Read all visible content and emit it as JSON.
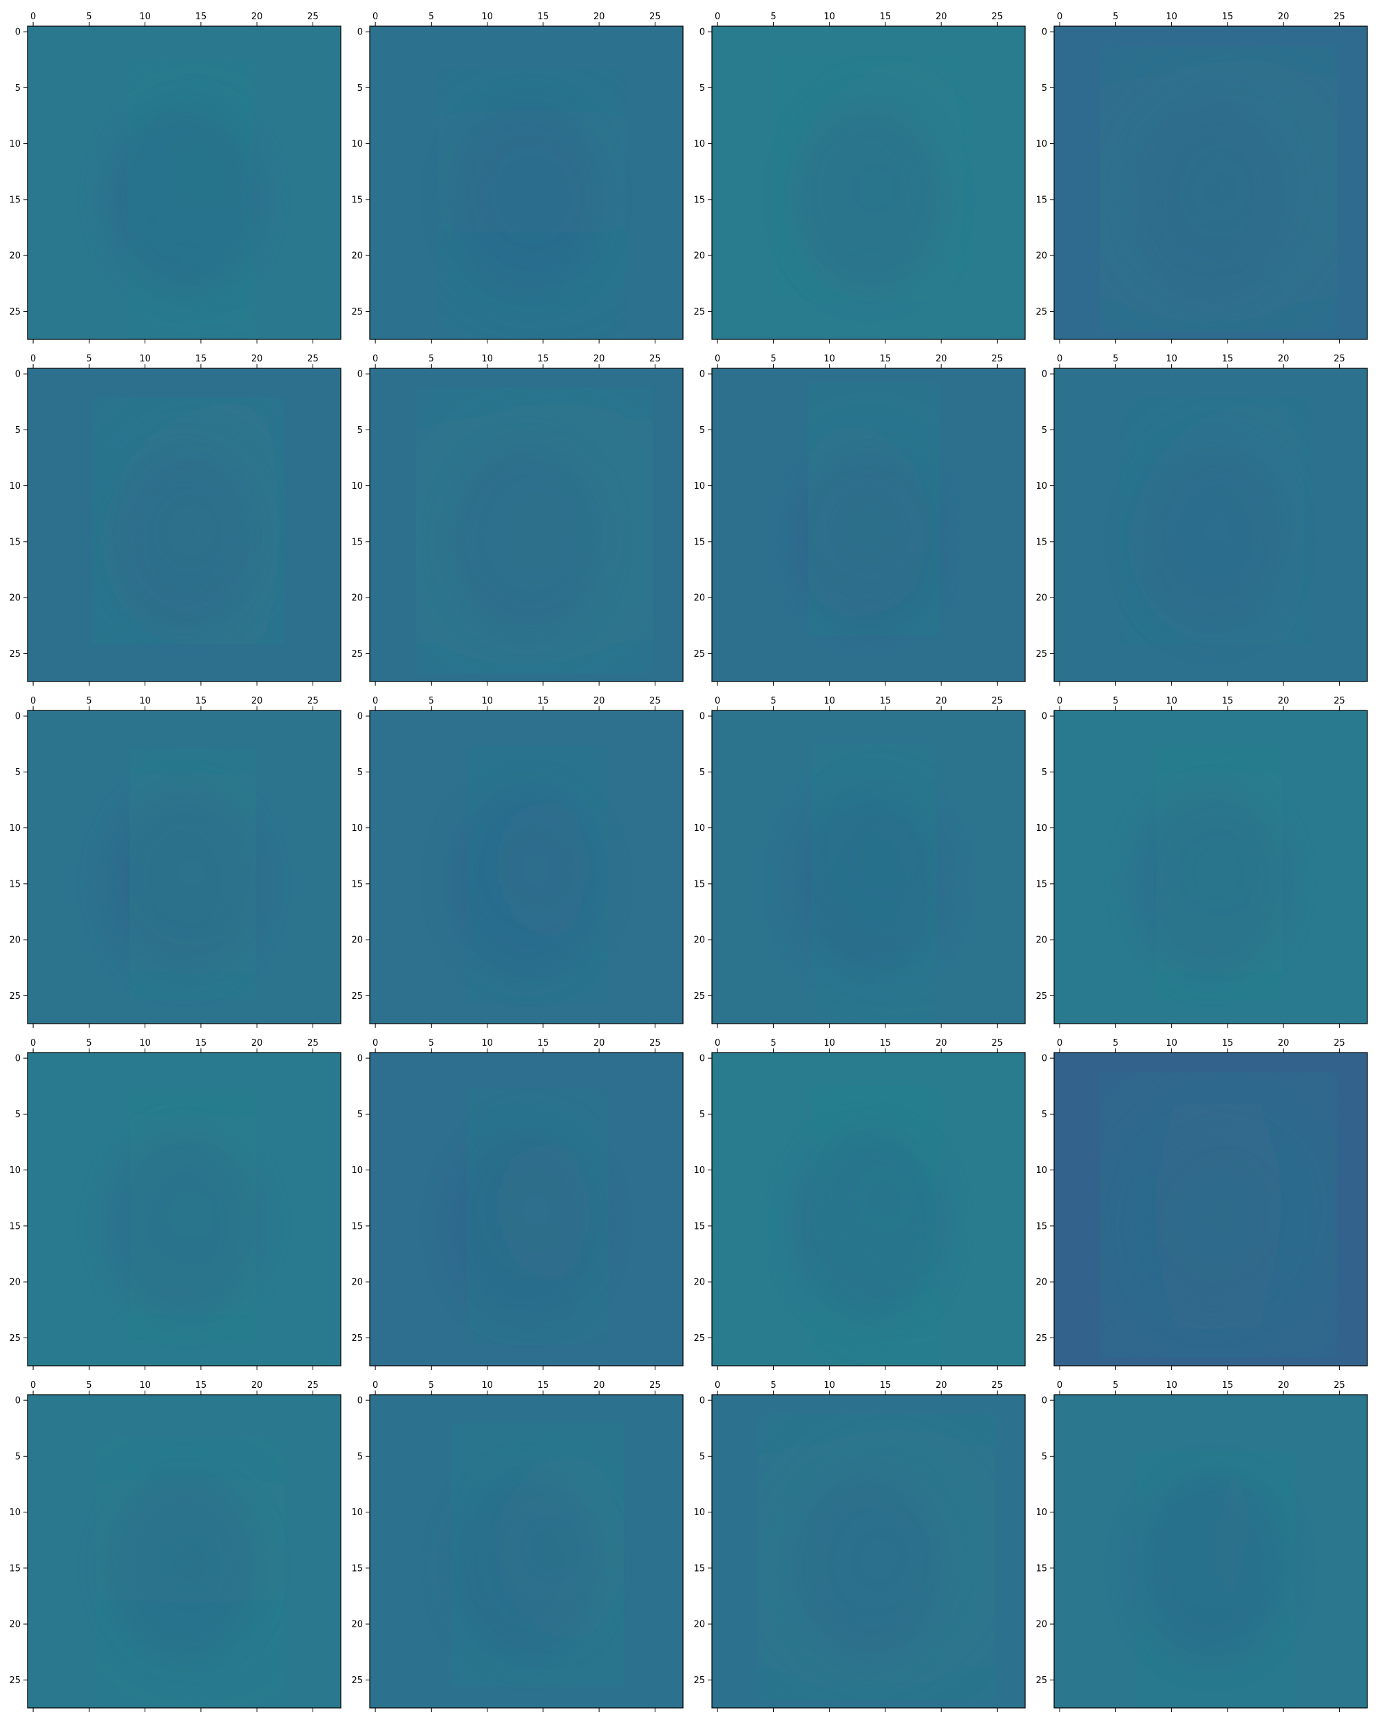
{
  "figure": {
    "rows": 5,
    "cols": 4,
    "cmap": "viridis"
  },
  "chart_data": {
    "type": "heatmap",
    "grid_shape": [
      5,
      4
    ],
    "image_shape": [
      28,
      28
    ],
    "x_axis": {
      "position": "top",
      "xlim": [
        -0.5,
        27.5
      ],
      "ticks": [
        0,
        5,
        10,
        15,
        20,
        25
      ]
    },
    "y_axis": {
      "ylim": [
        27.5,
        -0.5
      ],
      "ticks": [
        0,
        5,
        10,
        15,
        20,
        25
      ]
    },
    "grid": false,
    "legend": "none",
    "panels": [
      {
        "digit": "9",
        "background": "#2a788e",
        "stroke": "#23a083",
        "level": 0.45
      },
      {
        "digit": "4",
        "background": "#2c718e",
        "stroke": "#21918c",
        "level": 0.55
      },
      {
        "digit": "2",
        "background": "#297b8e",
        "stroke": "#23a083",
        "level": 0.25
      },
      {
        "digit": "0",
        "background": "#2f6b8e",
        "stroke": "#20a486",
        "level": 0.7
      },
      {
        "digit": "2",
        "background": "#2d708e",
        "stroke": "#22a884",
        "level": 0.75
      },
      {
        "digit": "0",
        "background": "#2d708e",
        "stroke": "#20a486",
        "level": 0.7
      },
      {
        "digit": "6",
        "background": "#2d708e",
        "stroke": "#22a884",
        "level": 0.75
      },
      {
        "digit": "2",
        "background": "#2c718e",
        "stroke": "#21918c",
        "level": 0.45
      },
      {
        "digit": "8",
        "background": "#2c738e",
        "stroke": "#22a884",
        "level": 0.65
      },
      {
        "digit": "5",
        "background": "#2d718e",
        "stroke": "#21918c",
        "level": 0.55
      },
      {
        "digit": "9",
        "background": "#2c738e",
        "stroke": "#20a486",
        "level": 0.6
      },
      {
        "digit": "8",
        "background": "#297a8e",
        "stroke": "#23a083",
        "level": 0.35
      },
      {
        "digit": "8",
        "background": "#297a8e",
        "stroke": "#23a083",
        "level": 0.3
      },
      {
        "digit": "5",
        "background": "#2e6e8e",
        "stroke": "#22a884",
        "level": 0.7
      },
      {
        "digit": "9",
        "background": "#287c8e",
        "stroke": "#23a083",
        "level": 0.3
      },
      {
        "digit": "0",
        "background": "#33638d",
        "stroke": "#1fa088",
        "level": 0.8
      },
      {
        "digit": "4",
        "background": "#2a788e",
        "stroke": "#23a083",
        "level": 0.4
      },
      {
        "digit": "3",
        "background": "#2c728e",
        "stroke": "#22a884",
        "level": 0.55
      },
      {
        "digit": "0",
        "background": "#2c728e",
        "stroke": "#23a083",
        "level": 0.5
      },
      {
        "digit": "7",
        "background": "#2a778e",
        "stroke": "#22a884",
        "level": 0.65
      }
    ]
  }
}
